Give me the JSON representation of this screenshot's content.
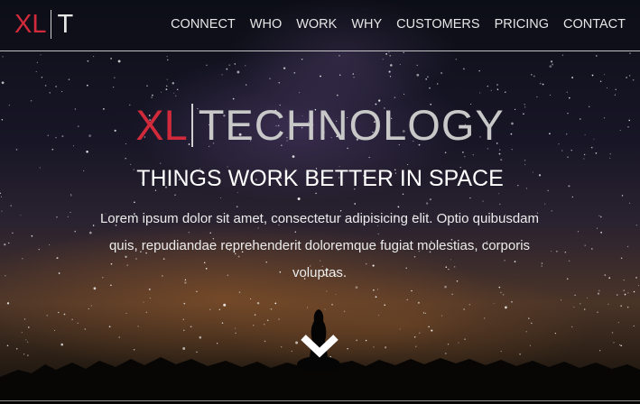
{
  "navbar": {
    "brand": {
      "xl": "XL",
      "t": "T"
    },
    "links": [
      "CONNECT",
      "WHO",
      "WORK",
      "WHY",
      "CUSTOMERS",
      "PRICING",
      "CONTACT"
    ]
  },
  "hero": {
    "logo_xl": "XL",
    "logo_word": "TECHNOLOGY",
    "tagline": "THINGS WORK BETTER IN SPACE",
    "lead": "Lorem ipsum dolor sit amet, consectetur adipisicing elit. Optio quibusdam quis, repudiandae reprehenderit doloremque fugiat molestias, corporis voluptas."
  },
  "icons": {
    "scroll": "chevron-down-icon"
  },
  "colors": {
    "accent": "#d12a3a",
    "text": "#ffffff",
    "muted": "#c8c8c8"
  }
}
